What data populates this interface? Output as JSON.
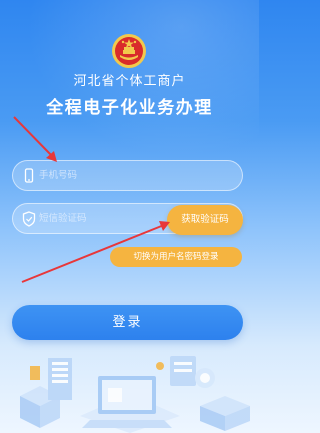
{
  "header": {
    "title_line1": "河北省个体工商户",
    "title_line2": "全程电子化业务办理",
    "emblem_icon": "national-emblem-icon"
  },
  "form": {
    "phone": {
      "placeholder": "手机号码",
      "value": "",
      "icon": "phone-icon"
    },
    "sms": {
      "placeholder": "短信验证码",
      "value": "",
      "icon": "shield-icon"
    },
    "get_code_label": "获取验证码",
    "switch_label": "切换为用户名密码登录",
    "login_label": "登录"
  },
  "annotations": {
    "arrow_color": "#e8373a"
  },
  "colors": {
    "accent_orange": "#f5b440",
    "primary_blue": "#2f86f0"
  }
}
